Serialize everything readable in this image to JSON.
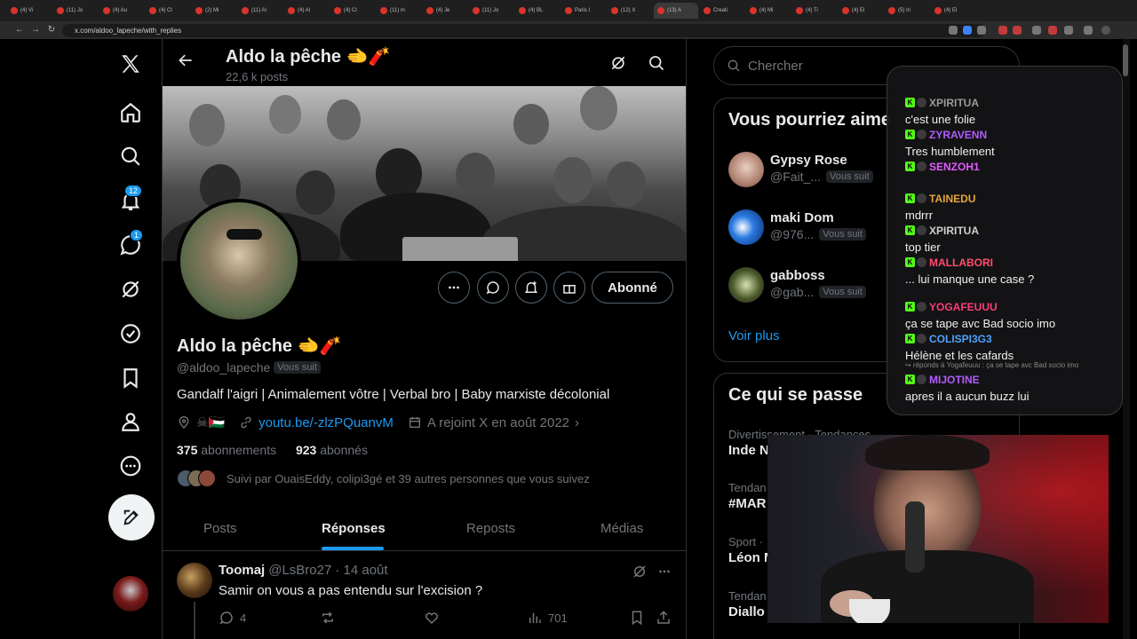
{
  "browser": {
    "tabs": [
      "(4) Vi",
      "(11) Jo",
      "(4) Au",
      "(4) Cl",
      "(2) Mi",
      "(11) Al",
      "(4) Al",
      "(4) Cl",
      "(11) m",
      "(4) Je",
      "(11) Jo",
      "(4) BL",
      "Paris I",
      "(12) X",
      "(13) A",
      "Creati",
      "(4) Mi",
      "(4) Ti",
      "(4) El",
      "(5) In",
      "(4) El"
    ],
    "active_tab_index": 14,
    "url": "x.com/aldoo_lapeche/with_replies"
  },
  "nav": {
    "notifications_badge": "12",
    "messages_badge": "1"
  },
  "header": {
    "name": "Aldo la pêche 🫲🧨",
    "posts_count": "22,6 k posts"
  },
  "profile": {
    "follow_button": "Abonné",
    "name": "Aldo la pêche 🫲🧨",
    "handle": "@aldoo_lapeche",
    "follows_you": "Vous suit",
    "bio": "Gandalf l'aigri | Animalement vôtre | Verbal bro | Baby marxiste décolonial",
    "location_flags": "☠🇵🇸",
    "link": "youtu.be/-zlzPQuanvM",
    "joined": "A rejoint X en août 2022",
    "following_count": "375",
    "following_label": "abonnements",
    "followers_count": "923",
    "followers_label": "abonnés",
    "followed_by": "Suivi par OuaisEddy, colipi3gé et 39 autres personnes que vous suivez"
  },
  "tabs": [
    "Posts",
    "Réponses",
    "Reposts",
    "Médias"
  ],
  "active_tab": "Réponses",
  "post": {
    "name": "Toomaj",
    "handle": "@LsBro27",
    "date": "· 14 août",
    "text": "Samir on vous a pas entendu sur l'excision ?",
    "replies": "4",
    "views": "701"
  },
  "search": {
    "placeholder": "Chercher"
  },
  "suggestions": {
    "title": "Vous pourriez aime",
    "items": [
      {
        "name": "Gypsy Rose",
        "handle": "@Fait_...",
        "pill": "Vous suit"
      },
      {
        "name": "maki Dom",
        "handle": "@976...",
        "pill": "Vous suit"
      },
      {
        "name": "gabboss",
        "handle": "@gab...",
        "pill": "Vous suit"
      }
    ],
    "more": "Voir plus"
  },
  "trends": {
    "title": "Ce qui se passe",
    "items": [
      {
        "context": "Divertissement · Tendances",
        "name": "Inde N"
      },
      {
        "context": "Tendan",
        "name": "#MAR"
      },
      {
        "context": "Sport ·",
        "name": "Léon M"
      },
      {
        "context": "Tendan",
        "name": "Diallo"
      }
    ]
  },
  "chat": {
    "messages": [
      {
        "user": "XPIRITUA",
        "color": "#9a9a9a",
        "text": "c'est une folie"
      },
      {
        "user": "ZYRAVENN",
        "color": "#b25cff",
        "text": "Tres humblement"
      },
      {
        "user": "SENZOH1",
        "color": "#e05cff",
        "text": ""
      },
      {
        "user": "TAINEDU",
        "color": "#e6a53c",
        "text": "mdrrr"
      },
      {
        "user": "XPIRITUA",
        "color": "#cfcfcf",
        "text": "top tier"
      },
      {
        "user": "MALLABORI",
        "color": "#ff4d6d",
        "text": "... lui manque une case ?"
      },
      {
        "user": "YOGAFEUUU",
        "color": "#ff3b7a",
        "text": "ça se tape avc Bad socio imo"
      },
      {
        "user": "COLISPI3G3",
        "color": "#4da3ff",
        "text": "Hélène et les cafards"
      },
      {
        "user": "MIJOTINE",
        "color": "#b25cff",
        "text": "apres il a aucun buzz lui"
      }
    ],
    "reply_note": "↪ réponds à Yogafeuuu : ça se tape avc Bad socio imo"
  }
}
